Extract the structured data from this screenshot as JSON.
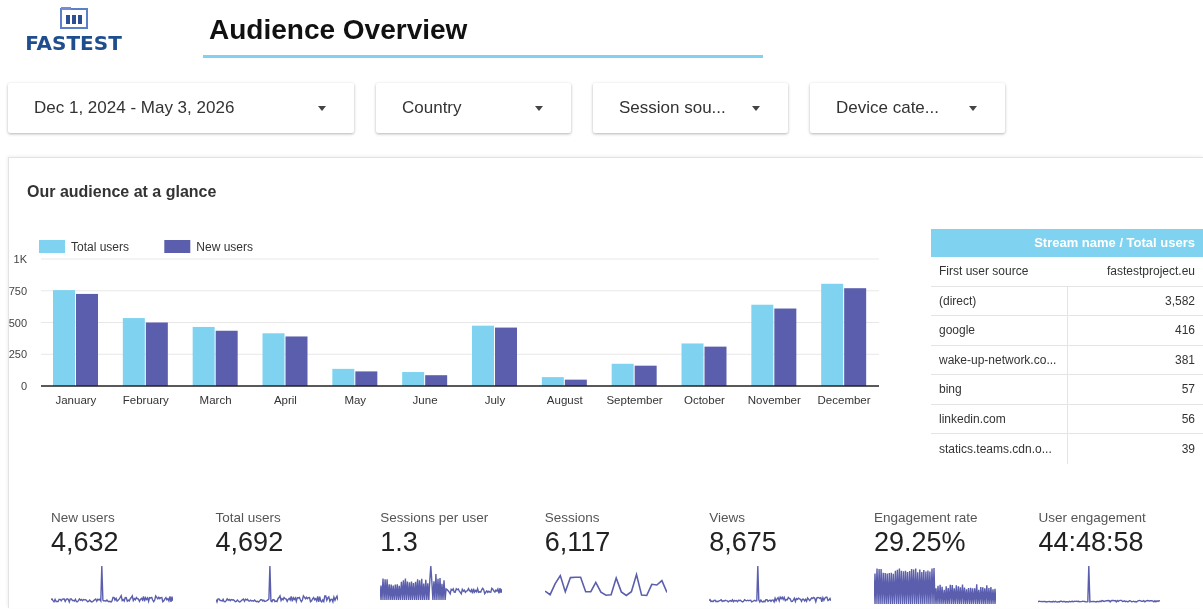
{
  "logo": {
    "text": "FASTEST"
  },
  "title": "Audience Overview",
  "filters": [
    {
      "label": "Dec 1, 2024 - May 3, 2026"
    },
    {
      "label": "Country"
    },
    {
      "label": "Session sou..."
    },
    {
      "label": "Device cate..."
    }
  ],
  "panel": {
    "title": "Our audience at a glance",
    "chart_data": {
      "type": "bar",
      "categories": [
        "January",
        "February",
        "March",
        "April",
        "May",
        "June",
        "July",
        "August",
        "September",
        "October",
        "November",
        "December"
      ],
      "series": [
        {
          "name": "Total users",
          "color": "#7fd3f0",
          "values": [
            755,
            535,
            465,
            415,
            135,
            110,
            475,
            70,
            175,
            335,
            640,
            805
          ]
        },
        {
          "name": "New users",
          "color": "#5a5ead",
          "values": [
            725,
            500,
            435,
            390,
            115,
            85,
            460,
            50,
            160,
            310,
            610,
            770
          ]
        }
      ],
      "grid": true,
      "legend": true,
      "ylim": [
        0,
        1000
      ],
      "yticks": [
        0,
        250,
        500,
        750,
        {
          "value": 1000,
          "label": "1K"
        }
      ]
    },
    "source_table": {
      "title": "Stream name / Total users",
      "columns": [
        "First user source",
        "fastestproject.eu"
      ],
      "rows": [
        [
          "(direct)",
          "3,582"
        ],
        [
          "google",
          "416"
        ],
        [
          "wake-up-network.co...",
          "381"
        ],
        [
          "bing",
          "57"
        ],
        [
          "linkedin.com",
          "56"
        ],
        [
          "statics.teams.cdn.o...",
          "39"
        ]
      ]
    },
    "metrics": [
      {
        "label": "New users",
        "value": "4,632"
      },
      {
        "label": "Total users",
        "value": "4,692"
      },
      {
        "label": "Sessions per user",
        "value": "1.3"
      },
      {
        "label": "Sessions",
        "value": "6,117"
      },
      {
        "label": "Views",
        "value": "8,675"
      },
      {
        "label": "Engagement rate",
        "value": "29.25%"
      },
      {
        "label": "User engagement",
        "value": "44:48:58"
      }
    ]
  }
}
